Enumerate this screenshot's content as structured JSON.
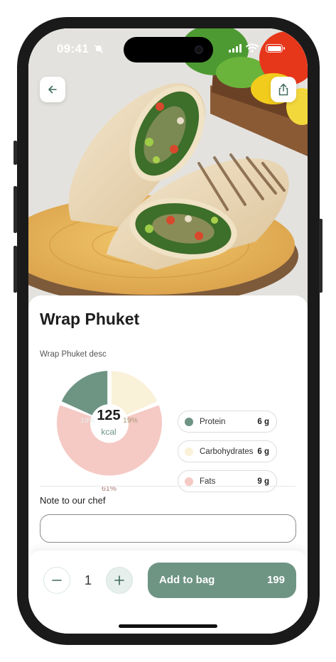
{
  "status_bar": {
    "time": "09:41"
  },
  "product": {
    "name": "Wrap Phuket",
    "description": "Wrap Phuket desc"
  },
  "nutrition": {
    "kcal_value": "125",
    "kcal_unit": "kcal",
    "items": [
      {
        "name": "Protein",
        "amount": "6 g",
        "percent": "19%",
        "color": "#6e9484"
      },
      {
        "name": "Carbohydrates",
        "amount": "6 g",
        "percent": "19%",
        "color": "#faf1d9"
      },
      {
        "name": "Fats",
        "amount": "9 g",
        "percent": "61%",
        "color": "#f5c9c4"
      }
    ]
  },
  "note": {
    "label": "Note to our chef",
    "value": "",
    "placeholder": ""
  },
  "footer": {
    "quantity": "1",
    "add_label": "Add to bag",
    "price": "199"
  },
  "colors": {
    "accent": "#6e9484",
    "protein": "#6e9484",
    "carbs": "#faf1d9",
    "fats": "#f5c9c4"
  },
  "icons": {
    "back": "arrow-left-icon",
    "share": "share-icon",
    "minus": "minus-icon",
    "plus": "plus-icon"
  }
}
